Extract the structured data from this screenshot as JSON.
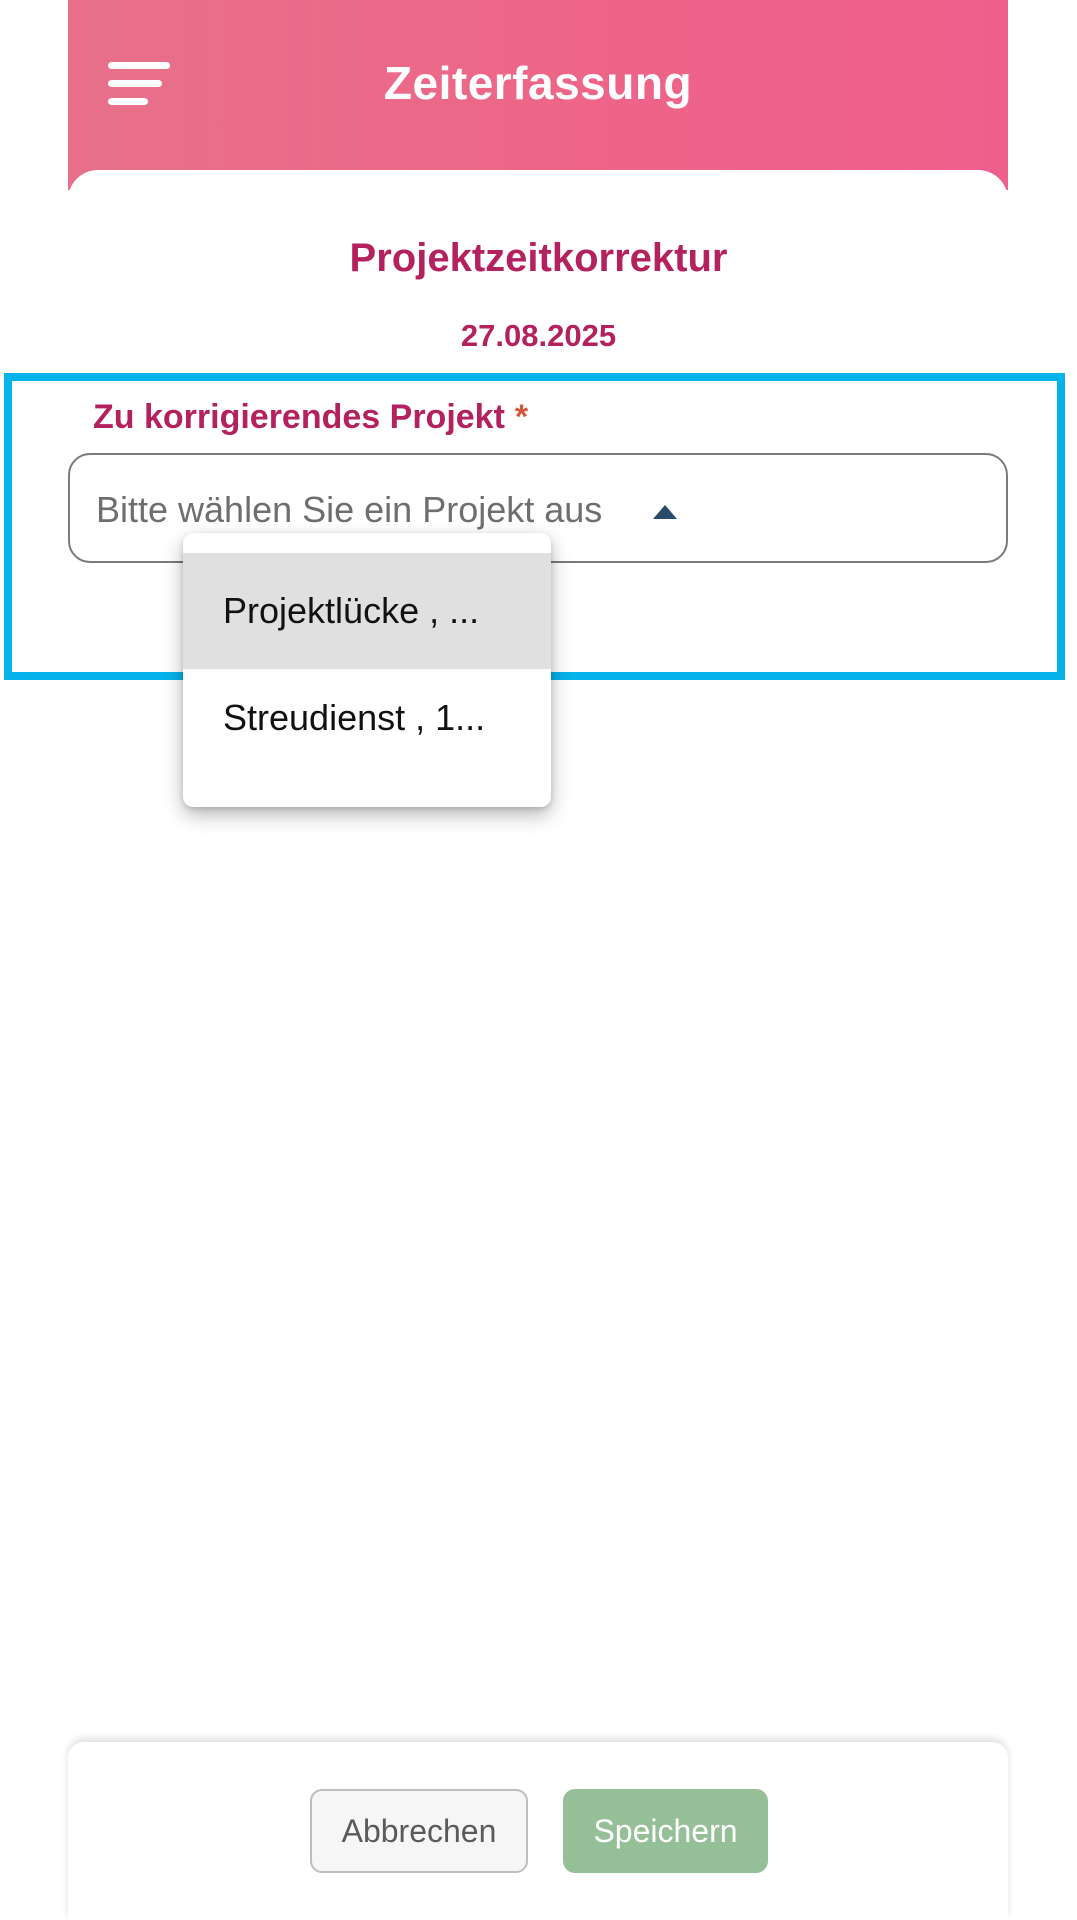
{
  "header": {
    "title": "Zeiterfassung",
    "menu_icon": "hamburger-menu-icon",
    "gradient_colors": [
      "#e8708a",
      "#ef5f8c"
    ]
  },
  "page": {
    "title": "Projektzeitkorrektur",
    "date": "27.08.2025"
  },
  "project_field": {
    "label": "Zu korrigierendes Projekt",
    "required_marker": "*",
    "placeholder": "Bitte wählen Sie ein Projekt aus",
    "caret_icon": "caret-up-icon",
    "options": [
      {
        "label": "Projektlücke , ...",
        "highlighted": true
      },
      {
        "label": "Streudienst , 1..."
      }
    ]
  },
  "footer": {
    "cancel_label": "Abbrechen",
    "save_label": "Speichern"
  },
  "colors": {
    "accent_text": "#b3225f",
    "required": "#cd5a3c",
    "focus_outline": "#06b2ea",
    "save_button": "#95c097"
  }
}
